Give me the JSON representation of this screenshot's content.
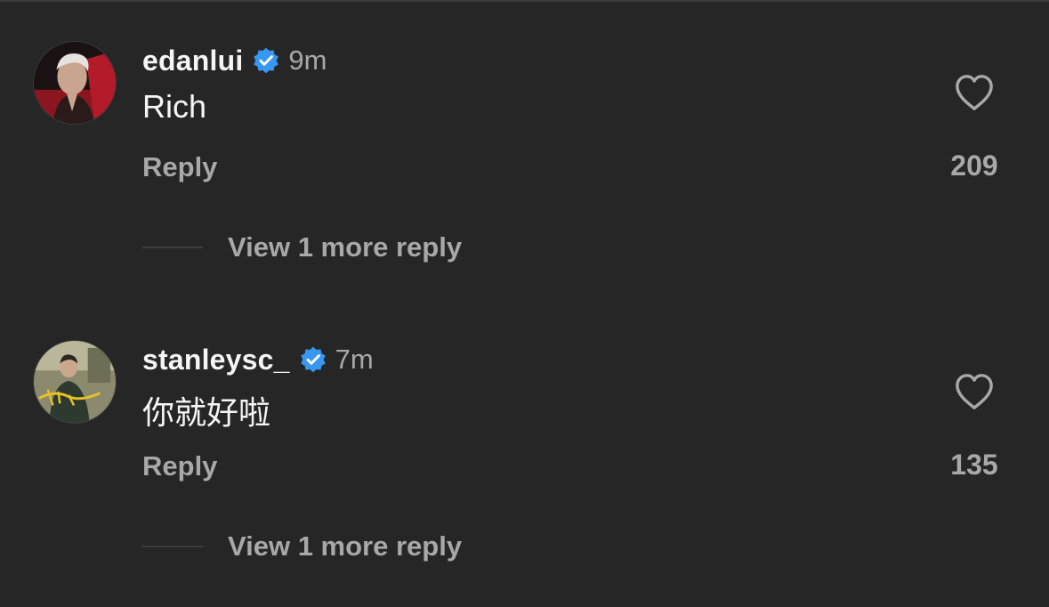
{
  "comments": [
    {
      "username": "edanlui",
      "verified": true,
      "time": "9m",
      "text": "Rich",
      "reply_label": "Reply",
      "view_more_label": "View 1 more reply",
      "likes": "209",
      "avatar_icon": "profile-photo"
    },
    {
      "username": "stanleysc_",
      "verified": true,
      "time": "7m",
      "text": "你就好啦",
      "reply_label": "Reply",
      "view_more_label": "View 1 more reply",
      "likes": "135",
      "avatar_icon": "profile-photo"
    }
  ],
  "colors": {
    "background": "#262626",
    "primary_text": "#f5f5f5",
    "secondary_text": "#a8a8a8",
    "verified_badge": "#3897f0"
  }
}
